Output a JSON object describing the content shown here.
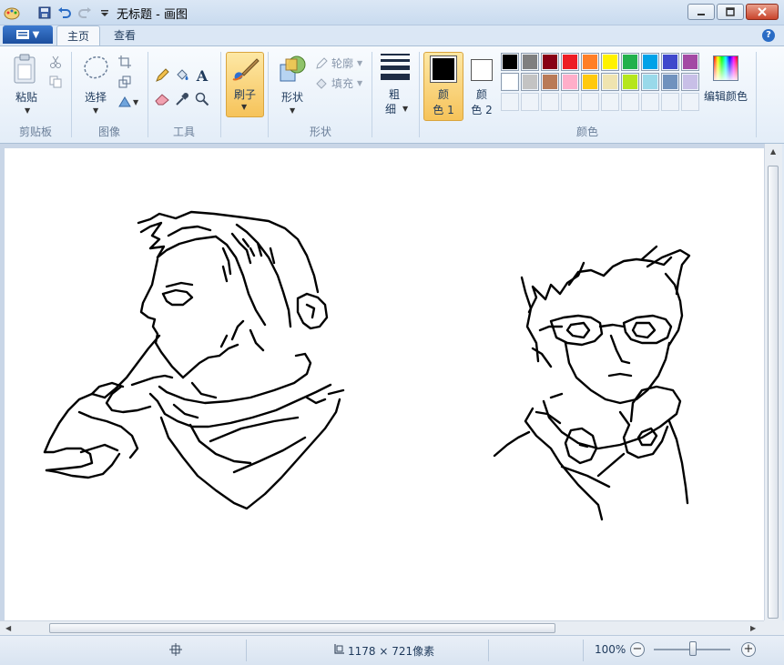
{
  "window": {
    "title": "无标题 - 画图"
  },
  "tabs": [
    {
      "label": "主页",
      "active": true
    },
    {
      "label": "查看",
      "active": false
    }
  ],
  "help_label": "?",
  "ribbon": {
    "clipboard": {
      "paste_label": "粘贴",
      "group_label": "剪贴板"
    },
    "image": {
      "select_label": "选择",
      "group_label": "图像"
    },
    "tools": {
      "text_tool_glyph": "A",
      "group_label": "工具"
    },
    "brushes": {
      "label": "刷子"
    },
    "shapes": {
      "label": "形状",
      "outline_label": "轮廓",
      "fill_label": "填充",
      "group_label": "形状"
    },
    "size": {
      "label_line1": "粗",
      "label_line2": "细"
    },
    "colors": {
      "color1_line1": "颜",
      "color1_line2": "色 1",
      "color2_line1": "颜",
      "color2_line2": "色 2",
      "edit_label": "编辑颜色",
      "group_label": "颜色",
      "color1_value": "#000000",
      "color2_value": "#ffffff",
      "palette_row1": [
        "#000000",
        "#7f7f7f",
        "#880015",
        "#ed1c24",
        "#ff7f27",
        "#fff200",
        "#22b14c",
        "#00a2e8",
        "#3f48cc",
        "#a349a4"
      ],
      "palette_row2": [
        "#ffffff",
        "#c3c3c3",
        "#b97a57",
        "#ffaec9",
        "#ffc90e",
        "#efe4b0",
        "#b5e61d",
        "#99d9ea",
        "#7092be",
        "#c8bfe7"
      ]
    }
  },
  "statusbar": {
    "dimensions": "1178 × 721像素",
    "zoom_label": "100%",
    "zoom_minus": "−",
    "zoom_plus": "+"
  }
}
